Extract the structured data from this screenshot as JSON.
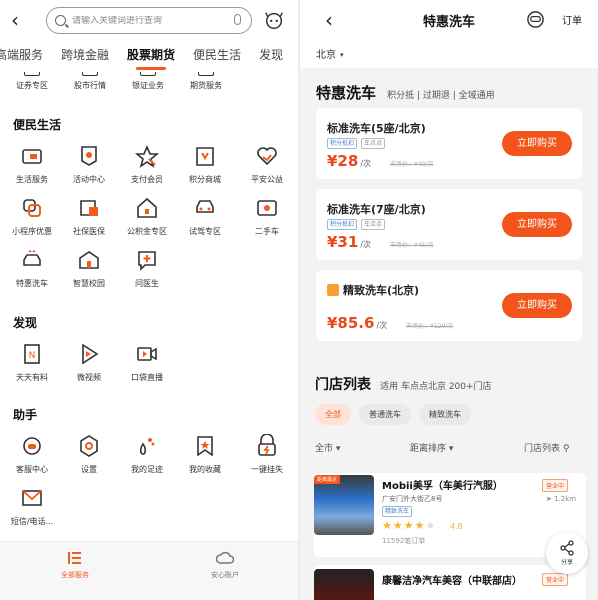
{
  "left": {
    "search": {
      "placeholder": "请输入关键词进行查询"
    },
    "tabs": [
      "高端服务",
      "跨境金融",
      "股票期货",
      "便民生活",
      "发现"
    ],
    "active_tab_index": 2,
    "top_row": [
      "证券专区",
      "股市行情",
      "银证业务",
      "期货服务"
    ],
    "sections": {
      "convenience": {
        "title": "便民生活",
        "items": [
          "生活服务",
          "活动中心",
          "支付会员",
          "积分商城",
          "平安公益",
          "小程序优惠",
          "社保医保",
          "公积金专区",
          "试驾专区",
          "二手车",
          "特惠洗车",
          "智慧校园",
          "问医生"
        ]
      },
      "discover": {
        "title": "发现",
        "items": [
          "天天有料",
          "微视频",
          "口袋直播"
        ]
      },
      "assistant": {
        "title": "助手",
        "items": [
          "客服中心",
          "设置",
          "我的足迹",
          "我的收藏",
          "一键挂失",
          "短信/电话..."
        ]
      }
    },
    "bottom_nav": [
      "全部服务",
      "安心账户"
    ],
    "accent_color": "#f25d1c"
  },
  "right": {
    "title": "特惠洗车",
    "orders_label": "订单",
    "city": "北京",
    "promo": {
      "title": "特惠洗车",
      "subtitle": "积分抵 | 过期退 | 全域通用"
    },
    "cards": [
      {
        "name": "标准洗车(5座/北京)",
        "tags": [
          "积分抵扣",
          "车点点"
        ],
        "price": "¥28",
        "unit": "/次",
        "orig": "市场价：¥40/次",
        "button": "立即购买"
      },
      {
        "name": "标准洗车(7座/北京)",
        "tags": [
          "积分抵扣",
          "车点点"
        ],
        "price": "¥31",
        "unit": "/次",
        "orig": "市场价：¥45/次",
        "button": "立即购买"
      },
      {
        "name": "精致洗车(北京)",
        "tags": [],
        "price": "¥85.6",
        "unit": "/次",
        "orig": "市场价：¥120/次",
        "button": "立即购买"
      }
    ],
    "shops_title": "门店列表",
    "shops_subtitle": "适用 车点点北京 200+门店",
    "chips": [
      "全部",
      "普通洗车",
      "精致洗车"
    ],
    "filters": {
      "city": "全市",
      "sort": "距离排序",
      "view": "门店列表"
    },
    "shops": [
      {
        "flag": "距离最近",
        "name": "Mobii美孚（车美行汽服）",
        "address": "广安门外大街乙8号",
        "tag": "精致洗车",
        "rating": "4.8",
        "orders": "11592笔订单",
        "status": "营业中",
        "distance": "1.2km"
      },
      {
        "name": "康馨洁净汽车美容（中联部店）",
        "status": "营业中"
      }
    ],
    "share_label": "分享",
    "brand_color": "#f2551c"
  }
}
